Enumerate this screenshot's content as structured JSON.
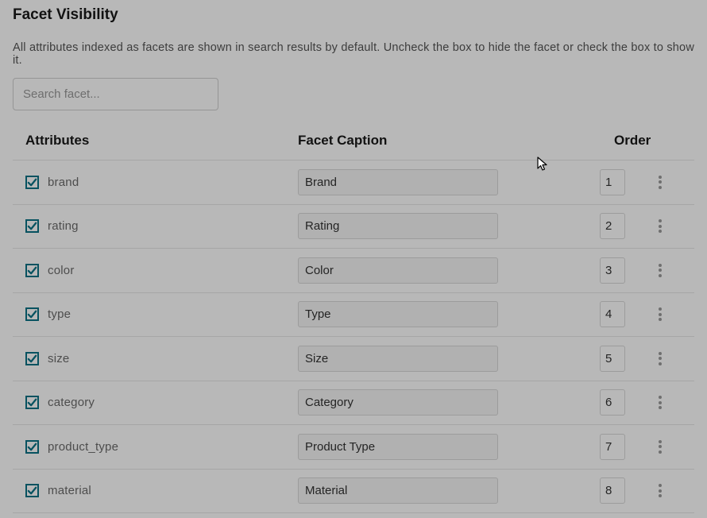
{
  "title": "Facet Visibility",
  "description": "All attributes indexed as facets are shown in search results by default. Uncheck the box to hide the facet or check the box to show it.",
  "search": {
    "placeholder": "Search facet..."
  },
  "columns": {
    "attributes": "Attributes",
    "caption": "Facet Caption",
    "order": "Order"
  },
  "rows": [
    {
      "checked": true,
      "attribute": "brand",
      "caption": "Brand",
      "order": "1"
    },
    {
      "checked": true,
      "attribute": "rating",
      "caption": "Rating",
      "order": "2"
    },
    {
      "checked": true,
      "attribute": "color",
      "caption": "Color",
      "order": "3"
    },
    {
      "checked": true,
      "attribute": "type",
      "caption": "Type",
      "order": "4"
    },
    {
      "checked": true,
      "attribute": "size",
      "caption": "Size",
      "order": "5"
    },
    {
      "checked": true,
      "attribute": "category",
      "caption": "Category",
      "order": "6"
    },
    {
      "checked": true,
      "attribute": "product_type",
      "caption": "Product Type",
      "order": "7"
    },
    {
      "checked": true,
      "attribute": "material",
      "caption": "Material",
      "order": "8"
    }
  ]
}
